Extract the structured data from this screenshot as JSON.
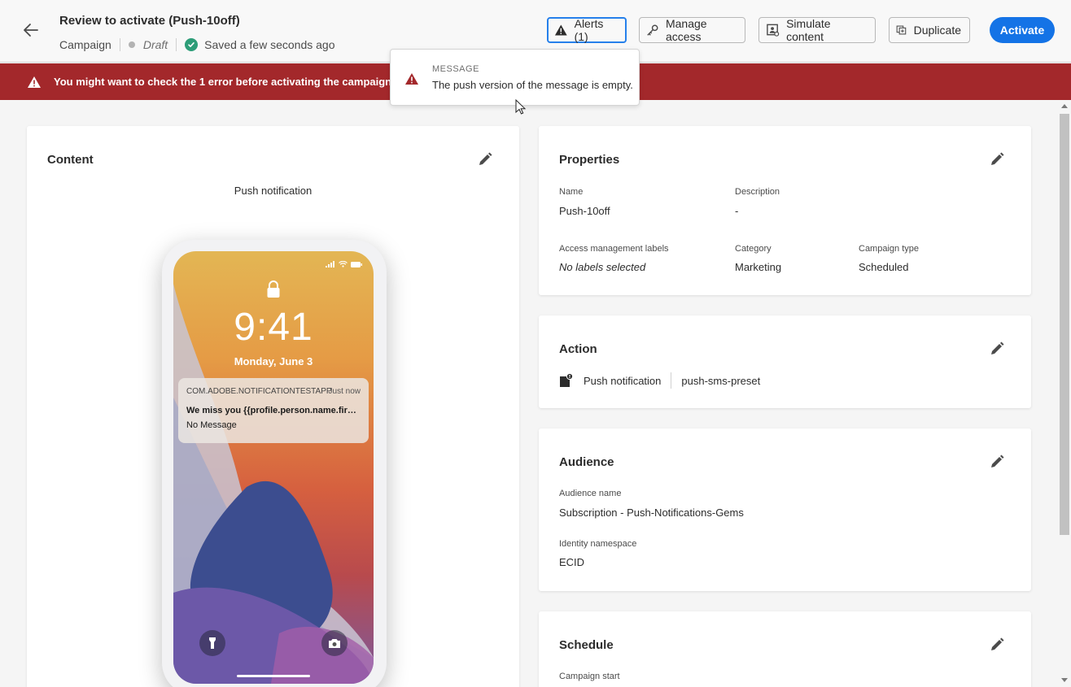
{
  "header": {
    "title": "Review to activate (Push-10off)",
    "type": "Campaign",
    "status": "Draft",
    "saved": "Saved a few seconds ago",
    "buttons": {
      "alerts": "Alerts (1)",
      "manage_access": "Manage access",
      "simulate": "Simulate content",
      "duplicate": "Duplicate",
      "activate": "Activate"
    }
  },
  "banner": {
    "text": "You might want to check the 1 error before activating the campaign."
  },
  "popover": {
    "label": "MESSAGE",
    "message": "The push version of the message is empty."
  },
  "content": {
    "title": "Content",
    "channel_label": "Push notification",
    "phone": {
      "time": "9:41",
      "date": "Monday, June 3",
      "notification": {
        "app": "COM.ADOBE.NOTIFICATIONTESTAPP",
        "time": "Just now",
        "title": "We miss you {{profile.person.name.first…",
        "body": "No Message"
      }
    }
  },
  "properties": {
    "title": "Properties",
    "name_label": "Name",
    "name_value": "Push-10off",
    "description_label": "Description",
    "description_value": "-",
    "access_label": "Access management labels",
    "access_value": "No labels selected",
    "category_label": "Category",
    "category_value": "Marketing",
    "type_label": "Campaign type",
    "type_value": "Scheduled"
  },
  "action": {
    "title": "Action",
    "channel": "Push notification",
    "preset": "push-sms-preset"
  },
  "audience": {
    "title": "Audience",
    "name_label": "Audience name",
    "name_value": "Subscription - Push-Notifications-Gems",
    "namespace_label": "Identity namespace",
    "namespace_value": "ECID"
  },
  "schedule": {
    "title": "Schedule",
    "start_label": "Campaign start"
  },
  "colors": {
    "accent": "#1473e6",
    "error": "#a3282b",
    "success": "#2d9d78"
  }
}
